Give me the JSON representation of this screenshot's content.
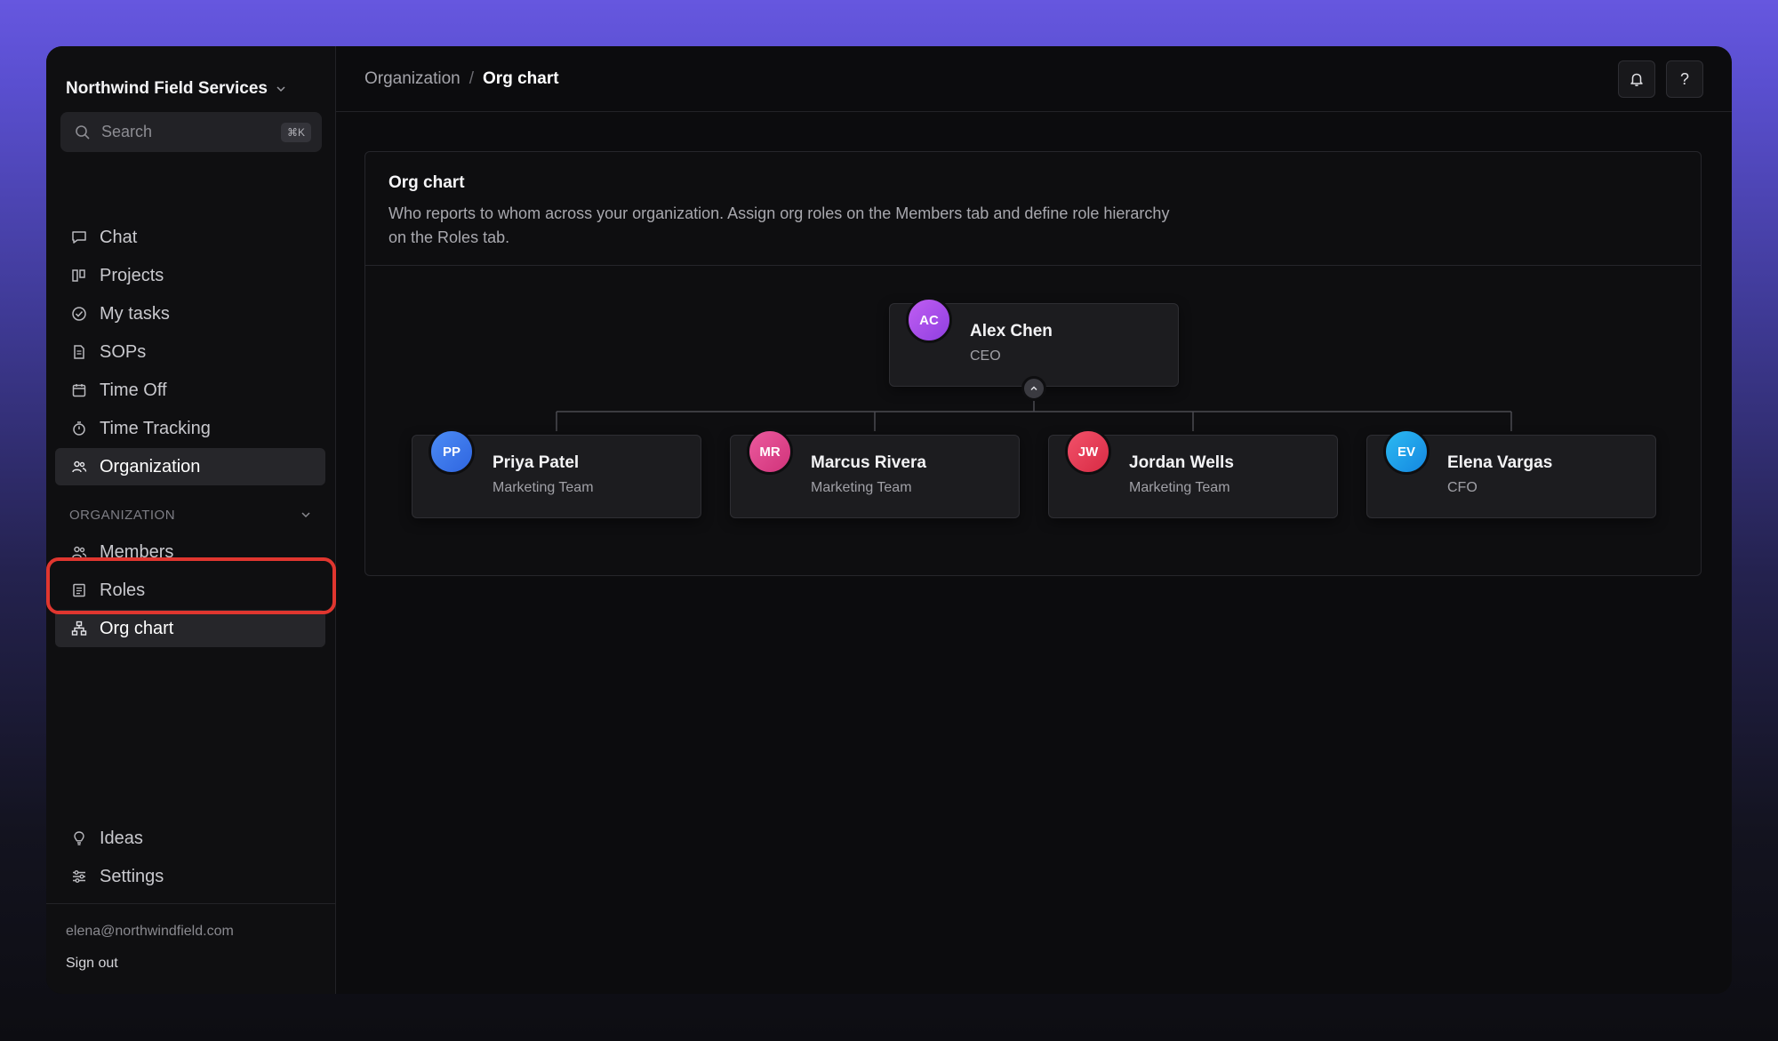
{
  "sidebar": {
    "workspace": "Northwind Field Services",
    "search": {
      "placeholder": "Search",
      "shortcut": "⌘K"
    },
    "nav": [
      {
        "label": "Chat",
        "icon": "chat-icon"
      },
      {
        "label": "Projects",
        "icon": "projects-icon"
      },
      {
        "label": "My tasks",
        "icon": "check-circle-icon"
      },
      {
        "label": "SOPs",
        "icon": "document-icon"
      },
      {
        "label": "Time Off",
        "icon": "calendar-icon"
      },
      {
        "label": "Time Tracking",
        "icon": "stopwatch-icon"
      },
      {
        "label": "Organization",
        "icon": "users-icon",
        "active": true
      }
    ],
    "section": {
      "label": "ORGANIZATION",
      "items": [
        {
          "label": "Members",
          "icon": "members-icon"
        },
        {
          "label": "Roles",
          "icon": "roles-icon"
        },
        {
          "label": "Org chart",
          "icon": "org-chart-icon",
          "active": true
        }
      ]
    },
    "bottom": [
      {
        "label": "Ideas",
        "icon": "lightbulb-icon"
      },
      {
        "label": "Settings",
        "icon": "sliders-icon"
      }
    ],
    "user_email": "elena@northwindfield.com",
    "sign_out": "Sign out"
  },
  "header": {
    "breadcrumb_parent": "Organization",
    "breadcrumb_separator": "/",
    "breadcrumb_current": "Org chart",
    "help_label": "?"
  },
  "panel": {
    "title": "Org chart",
    "description": "Who reports to whom across your organization. Assign org roles on the Members tab and define role hierarchy on the Roles tab."
  },
  "org": {
    "root": {
      "initials": "AC",
      "name": "Alex Chen",
      "role": "CEO",
      "color": "#a84ee8"
    },
    "reports": [
      {
        "initials": "PP",
        "name": "Priya Patel",
        "role": "Marketing Team",
        "color": "#3f7ef0"
      },
      {
        "initials": "MR",
        "name": "Marcus Rivera",
        "role": "Marketing Team",
        "color": "#e0418a"
      },
      {
        "initials": "JW",
        "name": "Jordan Wells",
        "role": "Marketing Team",
        "color": "#e8384e"
      },
      {
        "initials": "EV",
        "name": "Elena Vargas",
        "role": "CFO",
        "color": "#1fa6ee"
      }
    ]
  },
  "colors": {
    "accent_highlight": "#e0362f",
    "background_top": "#6657df"
  }
}
